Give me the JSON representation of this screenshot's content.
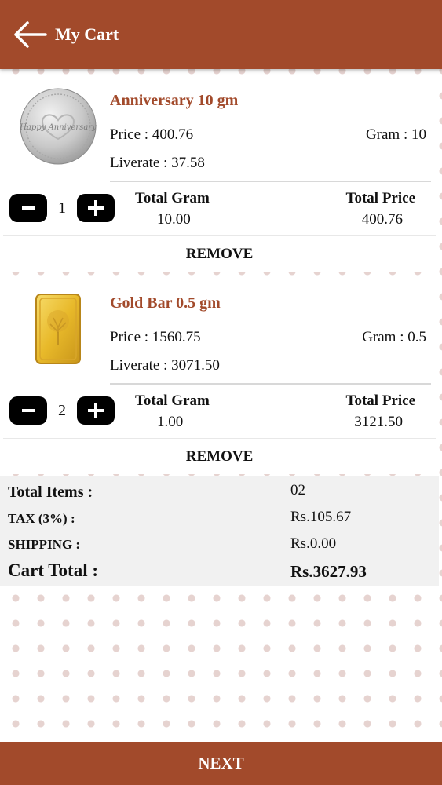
{
  "header": {
    "title": "My Cart",
    "back_icon": "arrow-left-icon"
  },
  "items": [
    {
      "name": "Anniversary 10 gm",
      "image_icon": "silver-coin-image",
      "coin_text": "Happy Anniversary",
      "price": "Price : 400.76",
      "gram": "Gram : 10",
      "liverate": "Liverate : 37.58",
      "quantity": "1",
      "total_gram_label": "Total Gram",
      "total_gram": "10.00",
      "total_price_label": "Total Price",
      "total_price": "400.76",
      "remove_label": "REMOVE"
    },
    {
      "name": "Gold Bar 0.5 gm",
      "image_icon": "gold-bar-image",
      "price": "Price : 1560.75",
      "gram": "Gram : 0.5",
      "liverate": "Liverate : 3071.50",
      "quantity": "2",
      "total_gram_label": "Total Gram",
      "total_gram": "1.00",
      "total_price_label": "Total Price",
      "total_price": "3121.50",
      "remove_label": "REMOVE"
    }
  ],
  "summary": {
    "total_items_label": "Total Items :",
    "total_items": "02",
    "tax_label": "TAX (3%) :",
    "tax": "Rs.105.67",
    "shipping_label": "SHIPPING :",
    "shipping": "Rs.0.00",
    "cart_total_label": "Cart Total :",
    "cart_total": "Rs.3627.93"
  },
  "footer": {
    "next_label": "NEXT"
  },
  "colors": {
    "brand": "#a24a2b",
    "dot": "#e6d3d0"
  }
}
